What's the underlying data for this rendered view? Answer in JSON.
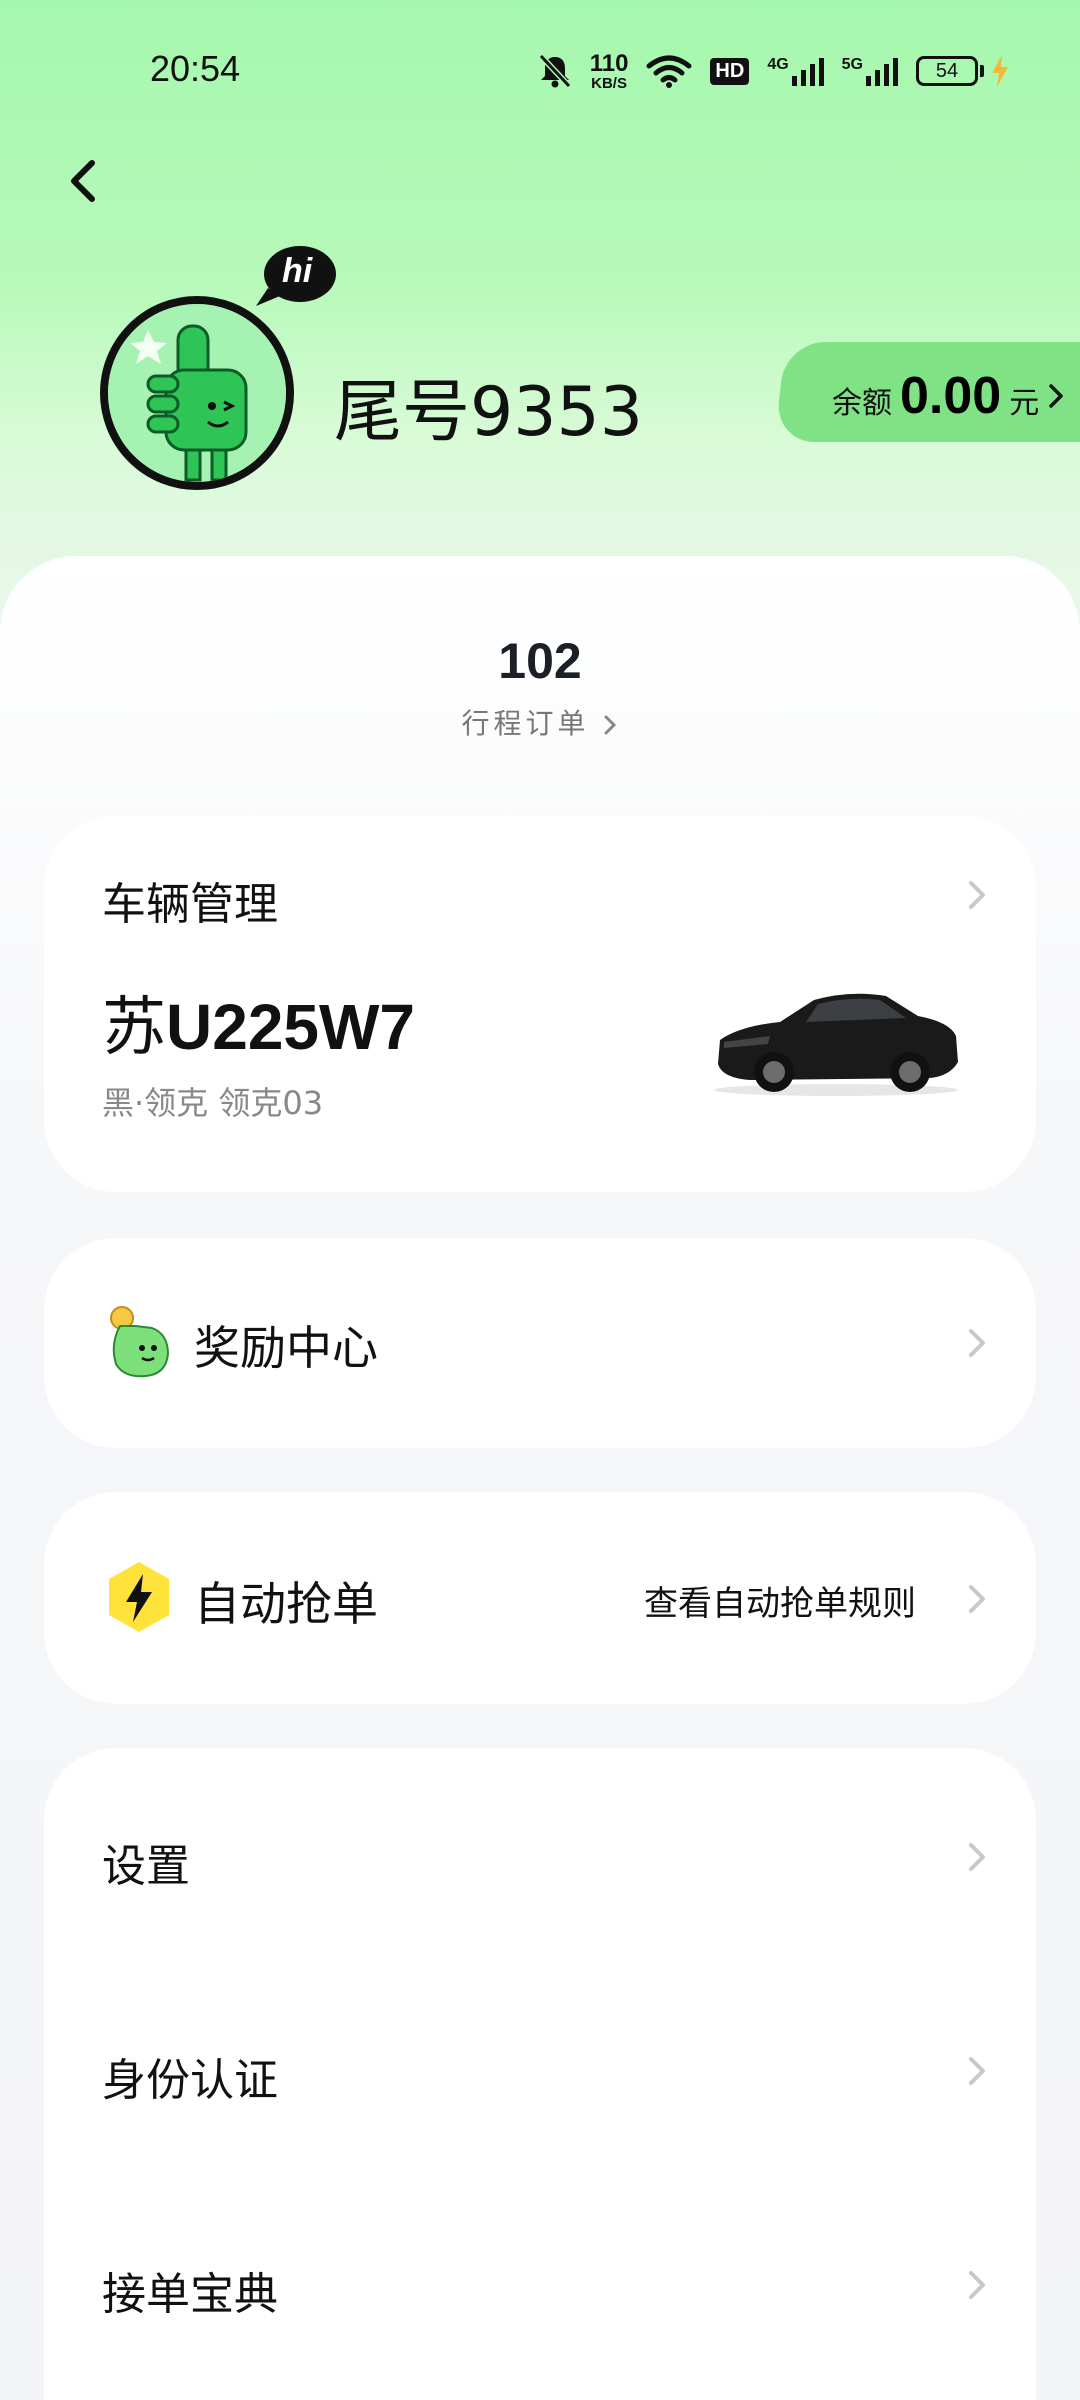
{
  "status_bar": {
    "time": "20:54",
    "net_speed_value": "110",
    "net_speed_unit": "KB/S",
    "hd_badge": "HD",
    "signal_1": "4G",
    "signal_2": "5G",
    "battery": "54"
  },
  "profile": {
    "bubble_text": "hi",
    "name": "尾号9353",
    "balance_label": "余额",
    "balance_value": "0.00",
    "balance_unit": "元"
  },
  "stats": {
    "order_count": "102",
    "order_label": "行程订单"
  },
  "vehicle": {
    "title": "车辆管理",
    "plate_prefix": "苏",
    "plate_number": "U225W7",
    "description": "黑·领克 领克03"
  },
  "rewards": {
    "label": "奖励中心"
  },
  "auto_grab": {
    "label": "自动抢单",
    "link": "查看自动抢单规则"
  },
  "menu": [
    {
      "label": "设置"
    },
    {
      "label": "身份认证"
    },
    {
      "label": "接单宝典"
    }
  ],
  "colors": {
    "brand_green": "#a6f7ae",
    "balance_pill": "#7fe386",
    "bolt_yellow": "#ffe33b"
  }
}
